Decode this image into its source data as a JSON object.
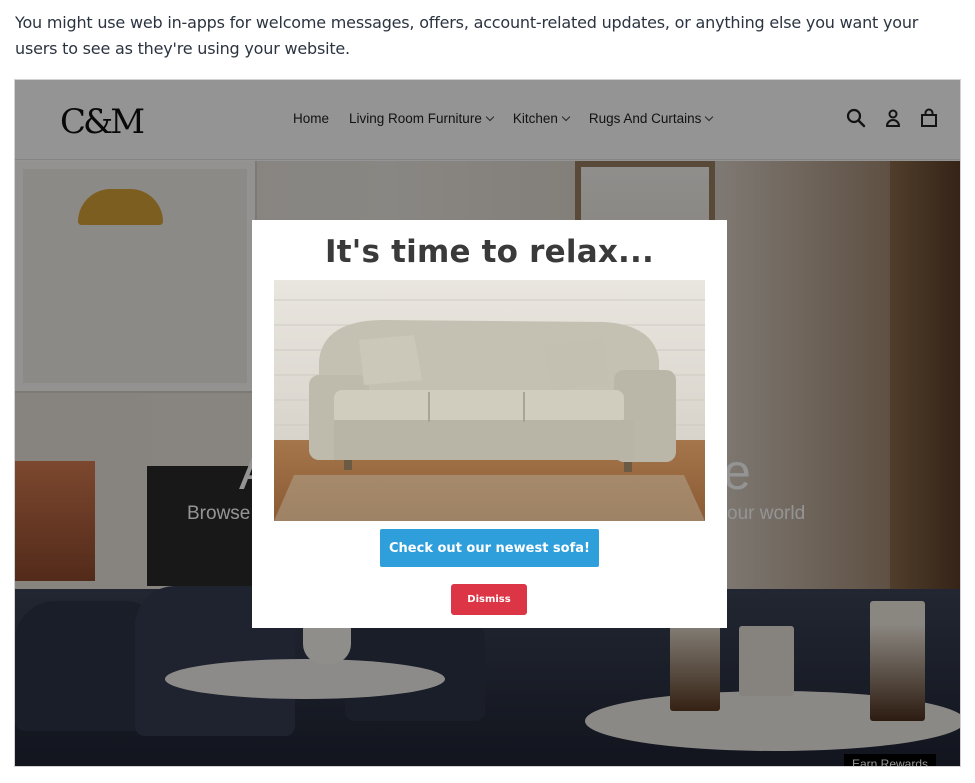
{
  "intro": {
    "text": "You might use web in-apps for welcome messages, offers, account-related updates, or anything else you want your users to see as they're using your website."
  },
  "site": {
    "logo": "C&M",
    "nav": [
      {
        "label": "Home",
        "has_dropdown": false
      },
      {
        "label": "Living Room Furniture",
        "has_dropdown": true
      },
      {
        "label": "Kitchen",
        "has_dropdown": true
      },
      {
        "label": "Rugs And Curtains",
        "has_dropdown": true
      }
    ],
    "icons": [
      "search-icon",
      "account-icon",
      "cart-icon"
    ]
  },
  "hero": {
    "title_left": "A",
    "title_right": "e",
    "subtitle_left": "Browse",
    "subtitle_right": "our world",
    "earn_rewards": "Earn Rewards"
  },
  "modal": {
    "title": "It's time to relax...",
    "image": "sofa-image",
    "cta_label": "Check out our newest sofa!",
    "dismiss_label": "Dismiss",
    "colors": {
      "cta": "#2f9fdc",
      "dismiss": "#dc3545"
    }
  }
}
